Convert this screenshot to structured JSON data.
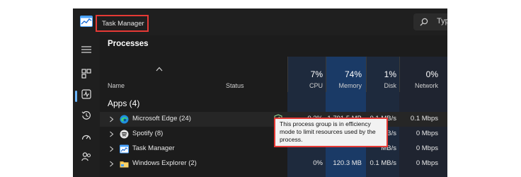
{
  "window": {
    "title": "Task Manager",
    "search": {
      "text": "Typ",
      "icon": "search-icon"
    },
    "logo_icon": "task-manager-logo-icon"
  },
  "sidebar": {
    "items": [
      {
        "name": "hamburger-menu",
        "icon": "hamburger-icon"
      },
      {
        "name": "processes",
        "icon": "processes-icon",
        "active": true
      },
      {
        "name": "performance",
        "icon": "performance-icon"
      },
      {
        "name": "app-history",
        "icon": "history-icon"
      },
      {
        "name": "startup-apps",
        "icon": "speedometer-icon"
      },
      {
        "name": "users",
        "icon": "users-icon"
      }
    ]
  },
  "main": {
    "heading": "Processes",
    "columns": {
      "name": "Name",
      "status": "Status",
      "cpu": {
        "pct": "7%",
        "label": "CPU"
      },
      "memory": {
        "pct": "74%",
        "label": "Memory"
      },
      "disk": {
        "pct": "1%",
        "label": "Disk"
      },
      "network": {
        "pct": "0%",
        "label": "Network"
      }
    },
    "group": "Apps (4)",
    "rows": [
      {
        "name": "Microsoft Edge (24)",
        "icon": "edge-icon",
        "efficiency": true,
        "cpu": "0.3%",
        "memory": "1,791.5 MB",
        "disk": "0.1 MB/s",
        "network": "0.1 Mbps"
      },
      {
        "name": "Spotify (8)",
        "icon": "spotify-icon",
        "cpu": "",
        "memory": "",
        "disk": "MB/s",
        "network": "0 Mbps"
      },
      {
        "name": "Task Manager",
        "icon": "task-manager-icon",
        "cpu": "",
        "memory": "",
        "disk": "MB/s",
        "network": "0 Mbps"
      },
      {
        "name": "Windows Explorer (2)",
        "icon": "folder-icon",
        "cpu": "0%",
        "memory": "120.3 MB",
        "disk": "0.1 MB/s",
        "network": "0 Mbps"
      }
    ],
    "tooltip": "This process group is in efficiency mode to limit resources used by the process."
  },
  "colors": {
    "background": "#1c1c1c",
    "highlight_box": "#e53935",
    "accent": "#6cb6ff",
    "memory_heat": "#1a3a66",
    "cpu_heat": "#1b2f4f"
  }
}
